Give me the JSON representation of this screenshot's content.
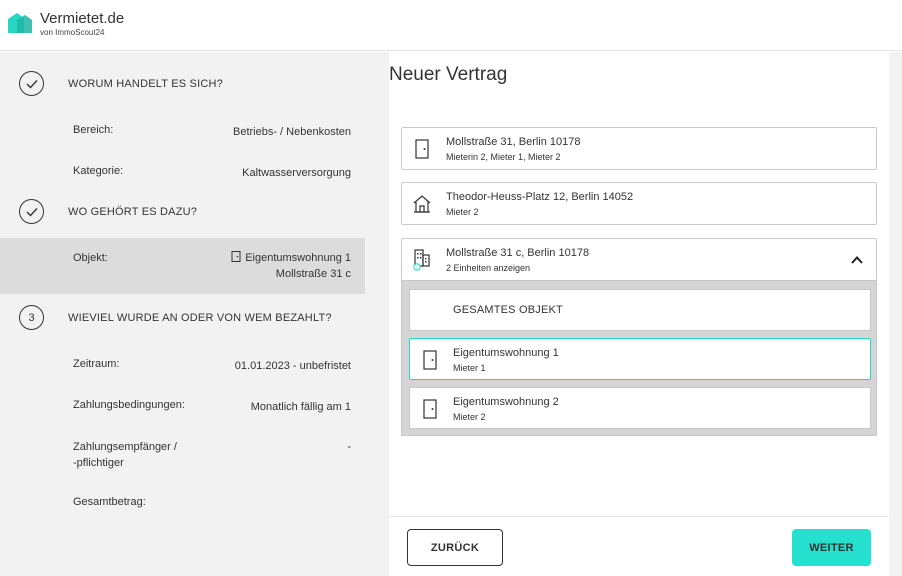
{
  "brand": {
    "name": "Vermietet.de",
    "sub": "von ImmoScout24",
    "color": "#26d7c4"
  },
  "sidebar": {
    "step1": {
      "title": "WORUM HANDELT ES SICH?",
      "state": "done"
    },
    "bereich": {
      "label": "Bereich:",
      "value": "Betriebs- / Nebenkosten"
    },
    "kategorie": {
      "label": "Kategorie:",
      "value": "Kaltwasserversorgung"
    },
    "step2": {
      "title": "WO GEHÖRT ES DAZU?",
      "state": "done"
    },
    "objekt": {
      "label": "Objekt:",
      "value1": "Eigentumswohnung 1",
      "value2": "Mollstraße 31 c"
    },
    "step3": {
      "number": "3",
      "title": "WIEVIEL WURDE AN ODER VON WEM BEZAHLT?"
    },
    "zeitraum": {
      "label": "Zeitraum:",
      "value": "01.01.2023 - unbefristet"
    },
    "zahlungsbedingungen": {
      "label": "Zahlungsbedingungen:",
      "value": "Monatlich fällig am 1"
    },
    "empfaenger": {
      "label1": "Zahlungsempfänger /",
      "label2": "-pflichtiger",
      "value": "-"
    },
    "gesamtbetrag": {
      "label": "Gesamtbetrag:"
    }
  },
  "main": {
    "title": "Neuer Vertrag",
    "properties": [
      {
        "address": "Mollstraße 31, Berlin 10178",
        "sub": "Mieterin 2, Mieter 1, Mieter 2",
        "icon": "door-icon"
      },
      {
        "address": "Theodor-Heuss-Platz 12, Berlin 14052",
        "sub": "Mieter 2",
        "icon": "house-icon"
      },
      {
        "address": "Mollstraße 31 c, Berlin 10178",
        "sub": "2 Einheiten anzeigen",
        "icon": "building-icon",
        "expanded": true
      }
    ],
    "units": {
      "all": "GESAMTES OBJEKT",
      "items": [
        {
          "name": "Eigentumswohnung 1",
          "sub": "Mieter 1",
          "selected": true
        },
        {
          "name": "Eigentumswohnung 2",
          "sub": "Mieter 2",
          "selected": false
        }
      ]
    },
    "back_label": "ZURÜCK",
    "next_label": "WEITER"
  }
}
